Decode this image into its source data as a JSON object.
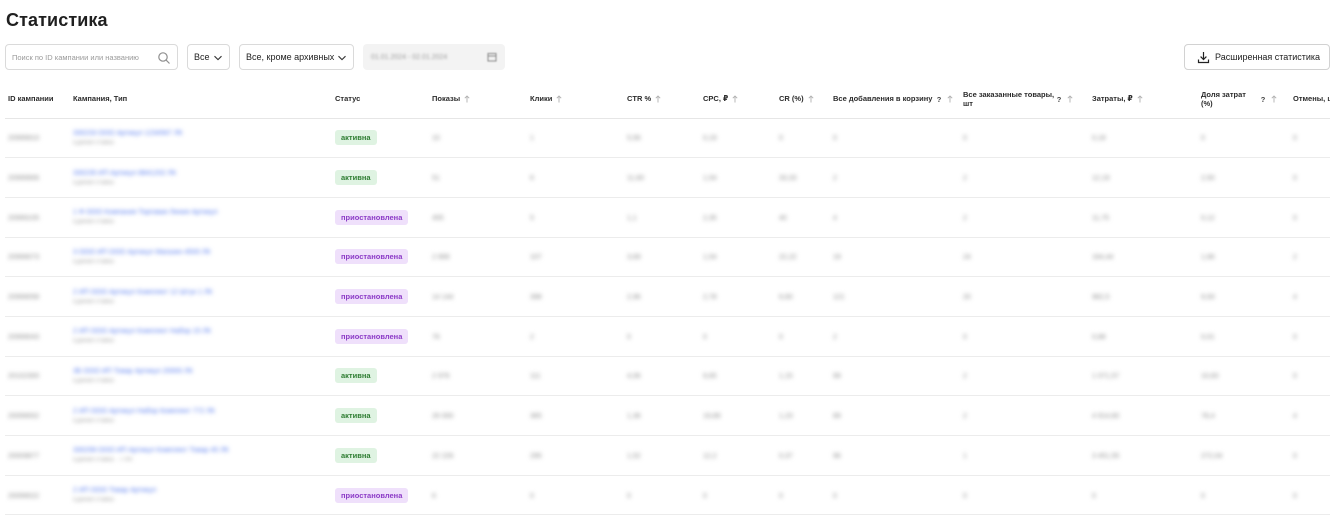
{
  "header": {
    "title": "Статистика"
  },
  "toolbar": {
    "search_placeholder": "Поиск по ID кампании или названию",
    "filter_type": "Все",
    "filter_archive": "Все, кроме архивных",
    "date_range": "01.01.2024 - 02.01.2024",
    "extended_stats_label": "Расширенная статистика"
  },
  "table": {
    "columns": [
      "ID кампании",
      "Кампания, Тип",
      "Статус",
      "Показы",
      "Клики",
      "CTR %",
      "CPC, ₽",
      "CR (%)",
      "Все добавления в корзину",
      "Все заказанные товары, шт",
      "Затраты, ₽",
      "Доля затрат (%)",
      "Отмены, шт"
    ],
    "rows": [
      {
        "id": "20999910",
        "name": "330233 ООО Артикул 1234567 ЛК",
        "sub": "Единая ставка",
        "status": "активна",
        "status_kind": "active",
        "shows": "10",
        "clicks": "1",
        "ctr": "5,56",
        "cpc": "0,19",
        "cr": "0",
        "cart": "0",
        "orders": "0",
        "spend": "0,18",
        "share": "0",
        "cancel": "0"
      },
      {
        "id": "20999906",
        "name": "330235 ИП Артикул 8841202 ЛК",
        "sub": "Единая ставка",
        "status": "активна",
        "status_kind": "active",
        "shows": "51",
        "clicks": "6",
        "ctr": "11,60",
        "cpc": "1,54",
        "cr": "33,33",
        "cart": "2",
        "orders": "2",
        "spend": "12,19",
        "share": "2,50",
        "cancel": "0"
      },
      {
        "id": "20999105",
        "name": "1 Ф ООО Компания Торговая Линия Артикул",
        "sub": "Единая ставка",
        "status": "приостановлена",
        "status_kind": "paused",
        "shows": "455",
        "clicks": "5",
        "ctr": "1,1",
        "cpc": "2,35",
        "cr": "40",
        "cart": "4",
        "orders": "2",
        "spend": "11,75",
        "share": "0,12",
        "cancel": "0"
      },
      {
        "id": "20999073",
        "name": "3 ООО ИП ООО Артикул Магазин 4500 ЛК",
        "sub": "Единая ставка",
        "status": "приостановлена",
        "status_kind": "paused",
        "shows": "2 899",
        "clicks": "107",
        "ctr": "3,69",
        "cpc": "1,54",
        "cr": "22,22",
        "cart": "19",
        "orders": "24",
        "spend": "164,44",
        "share": "1,66",
        "cancel": "2"
      },
      {
        "id": "20999058",
        "name": "2 ИП ООО Артикул Комплект 12 Штук 1 ЛК",
        "sub": "Единая ставка",
        "status": "приостановлена",
        "status_kind": "paused",
        "shows": "14 144",
        "clicks": "398",
        "ctr": "2,96",
        "cpc": "2,78",
        "cr": "6,60",
        "cart": "121",
        "orders": "20",
        "spend": "982,5",
        "share": "9,93",
        "cancel": "4"
      },
      {
        "id": "20999043",
        "name": "2 ИП ООО Артикул Комплект Набор 15 ЛК",
        "sub": "Единая ставка",
        "status": "приостановлена",
        "status_kind": "paused",
        "shows": "76",
        "clicks": "2",
        "ctr": "0",
        "cpc": "0",
        "cr": "0",
        "cart": "2",
        "orders": "0",
        "spend": "0,88",
        "share": "0,01",
        "cancel": "0"
      },
      {
        "id": "20102300",
        "name": "3Б ООО ИП Товар Артикул 20000 ЛК",
        "sub": "Единая ставка",
        "status": "активна",
        "status_kind": "active",
        "shows": "2 976",
        "clicks": "111",
        "ctr": "4,06",
        "cpc": "9,65",
        "cr": "1,15",
        "cart": "99",
        "orders": "2",
        "spend": "1 071,57",
        "share": "10,83",
        "cancel": "0"
      },
      {
        "id": "20099002",
        "name": "2 ИП ООО Артикул Набор Комплект 772 ЛК",
        "sub": "Единая ставка",
        "status": "активна",
        "status_kind": "active",
        "shows": "26 000",
        "clicks": "365",
        "ctr": "1,36",
        "cpc": "19,89",
        "cr": "1,23",
        "cart": "89",
        "orders": "2",
        "spend": "4 914,60",
        "share": "78,4",
        "cancel": "4"
      },
      {
        "id": "20009877",
        "name": "330299 ООО ИП Артикул Комплект Товар 45 ЛК",
        "sub": "Единая ставка · 7790",
        "status": "активна",
        "status_kind": "active",
        "shows": "22 226",
        "clicks": "295",
        "ctr": "1,52",
        "cpc": "12,2",
        "cr": "0,37",
        "cart": "96",
        "orders": "1",
        "spend": "3 451,55",
        "share": "272,04",
        "cancel": "0"
      },
      {
        "id": "20099022",
        "name": "2 ИП ООО Товар Артикул",
        "sub": "Единая ставка",
        "status": "приостановлена",
        "status_kind": "paused",
        "shows": "6",
        "clicks": "0",
        "ctr": "0",
        "cpc": "0",
        "cr": "0",
        "cart": "0",
        "orders": "0",
        "spend": "0",
        "share": "0",
        "cancel": "0"
      }
    ]
  }
}
